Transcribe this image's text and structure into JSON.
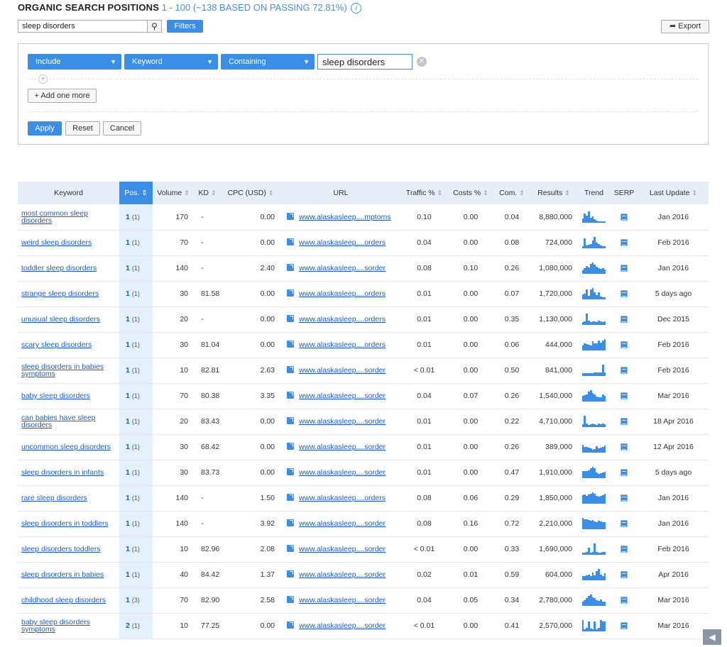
{
  "header": {
    "title": "ORGANIC SEARCH POSITIONS",
    "subtitle": "1 - 100 (~138 BASED ON PASSING 72.81%)",
    "info_icon": "info-icon"
  },
  "toolbar": {
    "search_value": "sleep disorders",
    "filters_label": "Filters",
    "export_label": "Export"
  },
  "filter": {
    "include": "Include",
    "field": "Keyword",
    "condition": "Containing",
    "value": "sleep disorders",
    "add_label": "+ Add one more",
    "apply_label": "Apply",
    "reset_label": "Reset",
    "cancel_label": "Cancel"
  },
  "table": {
    "columns": [
      "Keyword",
      "Pos.",
      "Volume",
      "KD",
      "CPC (USD)",
      "URL",
      "Traffic %",
      "Costs %",
      "Com.",
      "Results",
      "Trend",
      "SERP",
      "Last Update"
    ],
    "rows": [
      {
        "kw": "most common sleep disorders",
        "pos": "1",
        "prev": "(1)",
        "vol": "170",
        "kd": "-",
        "cpc": "0.00",
        "url": "www.alaskasleep....mptoms",
        "traffic": "0.10",
        "costs": "0.00",
        "com": "0.04",
        "results": "8,880,000",
        "upd": "Jan 2016",
        "trend": [
          0.35,
          0.8,
          0.6,
          1,
          0.45,
          0.55,
          0.3,
          0.2,
          0.15,
          0.15,
          0.1,
          0.1
        ]
      },
      {
        "kw": "weird sleep disorders",
        "pos": "1",
        "prev": "(1)",
        "vol": "70",
        "kd": "-",
        "cpc": "0.00",
        "url": "www.alaskasleep....orders",
        "traffic": "0.04",
        "costs": "0.00",
        "com": "0.08",
        "results": "724,000",
        "upd": "Feb 2016",
        "trend": [
          0.2,
          0.9,
          0.25,
          0.3,
          0.35,
          0.7,
          1,
          0.5,
          0.35,
          0.25,
          0.2,
          0.2
        ]
      },
      {
        "kw": "toddler sleep disorders",
        "pos": "1",
        "prev": "(1)",
        "vol": "140",
        "kd": "-",
        "cpc": "2.40",
        "url": "www.alaskasleep....sorder",
        "traffic": "0.08",
        "costs": "0.10",
        "com": "0.26",
        "results": "1,080,000",
        "upd": "Jan 2016",
        "trend": [
          0.3,
          0.5,
          0.7,
          0.55,
          0.9,
          1,
          0.8,
          0.6,
          0.5,
          0.45,
          0.5,
          0.4
        ]
      },
      {
        "kw": "strange sleep disorders",
        "pos": "1",
        "prev": "(1)",
        "vol": "30",
        "kd": "81.58",
        "cpc": "0.00",
        "url": "www.alaskasleep....orders",
        "traffic": "0.01",
        "costs": "0.00",
        "com": "0.07",
        "results": "1,720,000",
        "upd": "5 days ago",
        "trend": [
          0.45,
          0.5,
          0.9,
          0.3,
          0.85,
          1,
          0.6,
          0.35,
          0.65,
          0.25,
          0.2,
          0.2
        ]
      },
      {
        "kw": "unusual sleep disorders",
        "pos": "1",
        "prev": "(1)",
        "vol": "20",
        "kd": "-",
        "cpc": "0.00",
        "url": "www.alaskasleep....orders",
        "traffic": "0.01",
        "costs": "0.00",
        "com": "0.35",
        "results": "1,130,000",
        "upd": "Dec 2015",
        "trend": [
          0.25,
          0.3,
          1,
          0.35,
          0.25,
          0.3,
          0.3,
          0.25,
          0.35,
          0.3,
          0.25,
          0.3
        ]
      },
      {
        "kw": "scary sleep disorders",
        "pos": "1",
        "prev": "(1)",
        "vol": "30",
        "kd": "81.04",
        "cpc": "0.00",
        "url": "www.alaskasleep....orders",
        "traffic": "0.01",
        "costs": "0.00",
        "com": "0.06",
        "results": "444,000",
        "upd": "Feb 2016",
        "trend": [
          0.45,
          0.6,
          0.55,
          0.5,
          0.45,
          0.8,
          0.6,
          0.65,
          0.9,
          0.7,
          0.85,
          1
        ]
      },
      {
        "kw": "sleep disorders in babies symptoms",
        "pos": "1",
        "prev": "(1)",
        "vol": "10",
        "kd": "82.81",
        "cpc": "2.63",
        "url": "www.alaskasleep....sorder",
        "traffic": "< 0.01",
        "costs": "0.00",
        "com": "0.50",
        "results": "841,000",
        "upd": "Feb 2016",
        "trend": [
          0.25,
          0.25,
          0.25,
          0.25,
          0.25,
          0.25,
          0.3,
          0.3,
          0.3,
          0.3,
          1,
          0.3
        ]
      },
      {
        "kw": "baby sleep disorders",
        "pos": "1",
        "prev": "(1)",
        "vol": "70",
        "kd": "80.38",
        "cpc": "3.35",
        "url": "www.alaskasleep....sorder",
        "traffic": "0.04",
        "costs": "0.07",
        "com": "0.26",
        "results": "1,540,000",
        "upd": "Mar 2016",
        "trend": [
          0.5,
          0.55,
          0.6,
          0.9,
          1,
          0.75,
          0.6,
          0.45,
          0.4,
          0.35,
          0.6,
          0.5
        ]
      },
      {
        "kw": "can babies have sleep disorders",
        "pos": "1",
        "prev": "(1)",
        "vol": "20",
        "kd": "83.43",
        "cpc": "0.00",
        "url": "www.alaskasleep....sorder",
        "traffic": "0.01",
        "costs": "0.00",
        "com": "0.22",
        "results": "4,710,000",
        "upd": "18 Apr 2016",
        "trend": [
          0.25,
          1,
          0.3,
          0.2,
          0.25,
          0.3,
          0.25,
          0.2,
          0.3,
          0.25,
          0.3,
          0.25
        ]
      },
      {
        "kw": "uncommon sleep disorders",
        "pos": "1",
        "prev": "(1)",
        "vol": "30",
        "kd": "68.42",
        "cpc": "0.00",
        "url": "www.alaskasleep....sorder",
        "traffic": "0.01",
        "costs": "0.00",
        "com": "0.26",
        "results": "389,000",
        "upd": "12 Apr 2016",
        "trend": [
          0.7,
          0.5,
          0.5,
          0.45,
          0.4,
          0.25,
          0.3,
          0.55,
          0.4,
          0.45,
          0.5,
          0.65
        ]
      },
      {
        "kw": "sleep disorders in infants",
        "pos": "1",
        "prev": "(1)",
        "vol": "30",
        "kd": "83.73",
        "cpc": "0.00",
        "url": "www.alaskasleep....sorder",
        "traffic": "0.01",
        "costs": "0.00",
        "com": "0.47",
        "results": "1,910,000",
        "upd": "5 days ago",
        "trend": [
          0.6,
          0.65,
          0.6,
          0.7,
          0.9,
          1,
          0.85,
          0.5,
          0.4,
          0.45,
          0.5,
          0.55
        ]
      },
      {
        "kw": "rare sleep disorders",
        "pos": "1",
        "prev": "(1)",
        "vol": "140",
        "kd": "-",
        "cpc": "1.50",
        "url": "www.alaskasleep....orders",
        "traffic": "0.08",
        "costs": "0.06",
        "com": "0.29",
        "results": "1,850,000",
        "upd": "Jan 2016",
        "trend": [
          0.75,
          0.8,
          0.7,
          0.8,
          0.9,
          1,
          0.85,
          0.7,
          0.65,
          0.7,
          0.75,
          0.9
        ]
      },
      {
        "kw": "sleep disorders in toddlers",
        "pos": "1",
        "prev": "(1)",
        "vol": "140",
        "kd": "-",
        "cpc": "3.92",
        "url": "www.alaskasleep....sorder",
        "traffic": "0.08",
        "costs": "0.16",
        "com": "0.72",
        "results": "2,210,000",
        "upd": "Jan 2016",
        "trend": [
          1,
          0.85,
          0.9,
          0.8,
          0.75,
          0.8,
          0.7,
          0.65,
          0.75,
          0.7,
          0.65,
          0.6
        ]
      },
      {
        "kw": "sleep disorders toddlers",
        "pos": "1",
        "prev": "(1)",
        "vol": "10",
        "kd": "82.96",
        "cpc": "2.08",
        "url": "www.alaskasleep....sorder",
        "traffic": "< 0.01",
        "costs": "0.00",
        "com": "0.33",
        "results": "1,690,000",
        "upd": "Feb 2016",
        "trend": [
          0.2,
          0.2,
          0.25,
          0.6,
          0.2,
          0.25,
          1,
          0.25,
          0.2,
          0.2,
          0.25,
          0.25
        ]
      },
      {
        "kw": "sleep disorders in babies",
        "pos": "1",
        "prev": "(1)",
        "vol": "40",
        "kd": "84.42",
        "cpc": "1.37",
        "url": "www.alaskasleep....sorder",
        "traffic": "0.02",
        "costs": "0.01",
        "com": "0.59",
        "results": "604,000",
        "upd": "Apr 2016",
        "trend": [
          0.35,
          0.4,
          0.45,
          0.5,
          0.35,
          0.7,
          0.45,
          0.8,
          1,
          0.5,
          0.35,
          0.6
        ]
      },
      {
        "kw": "childhood sleep disorders",
        "pos": "1",
        "prev": "(3)",
        "vol": "70",
        "kd": "82.90",
        "cpc": "2.58",
        "url": "www.alaskasleep....sorder",
        "traffic": "0.04",
        "costs": "0.05",
        "com": "0.34",
        "results": "2,780,000",
        "upd": "Mar 2016",
        "trend": [
          0.4,
          0.5,
          0.7,
          0.9,
          1,
          0.75,
          0.7,
          0.5,
          0.45,
          0.55,
          0.4,
          0.35
        ]
      },
      {
        "kw": "baby sleep disorders symptoms",
        "pos": "2",
        "prev": "(1)",
        "vol": "10",
        "kd": "77.25",
        "cpc": "0.00",
        "url": "www.alaskasleep....sorder",
        "traffic": "< 0.01",
        "costs": "0.00",
        "com": "0.41",
        "results": "2,570,000",
        "upd": "Mar 2016",
        "trend": [
          1,
          0.2,
          0.3,
          0.9,
          0.25,
          0.2,
          0.85,
          0.2,
          0.3,
          1,
          0.9,
          0.85
        ]
      }
    ]
  },
  "icons": {
    "search": "search-icon",
    "export": "export-icon",
    "chevron": "chevron-down-icon",
    "clear": "clear-icon",
    "add": "plus-icon",
    "sort": "sort-icon",
    "external": "external-link-icon",
    "serp": "serp-icon",
    "corner": "feedback-icon"
  },
  "colors": {
    "accent": "#3a8ee6",
    "link": "#1d5fbf",
    "header_bg": "#e6eef7"
  }
}
